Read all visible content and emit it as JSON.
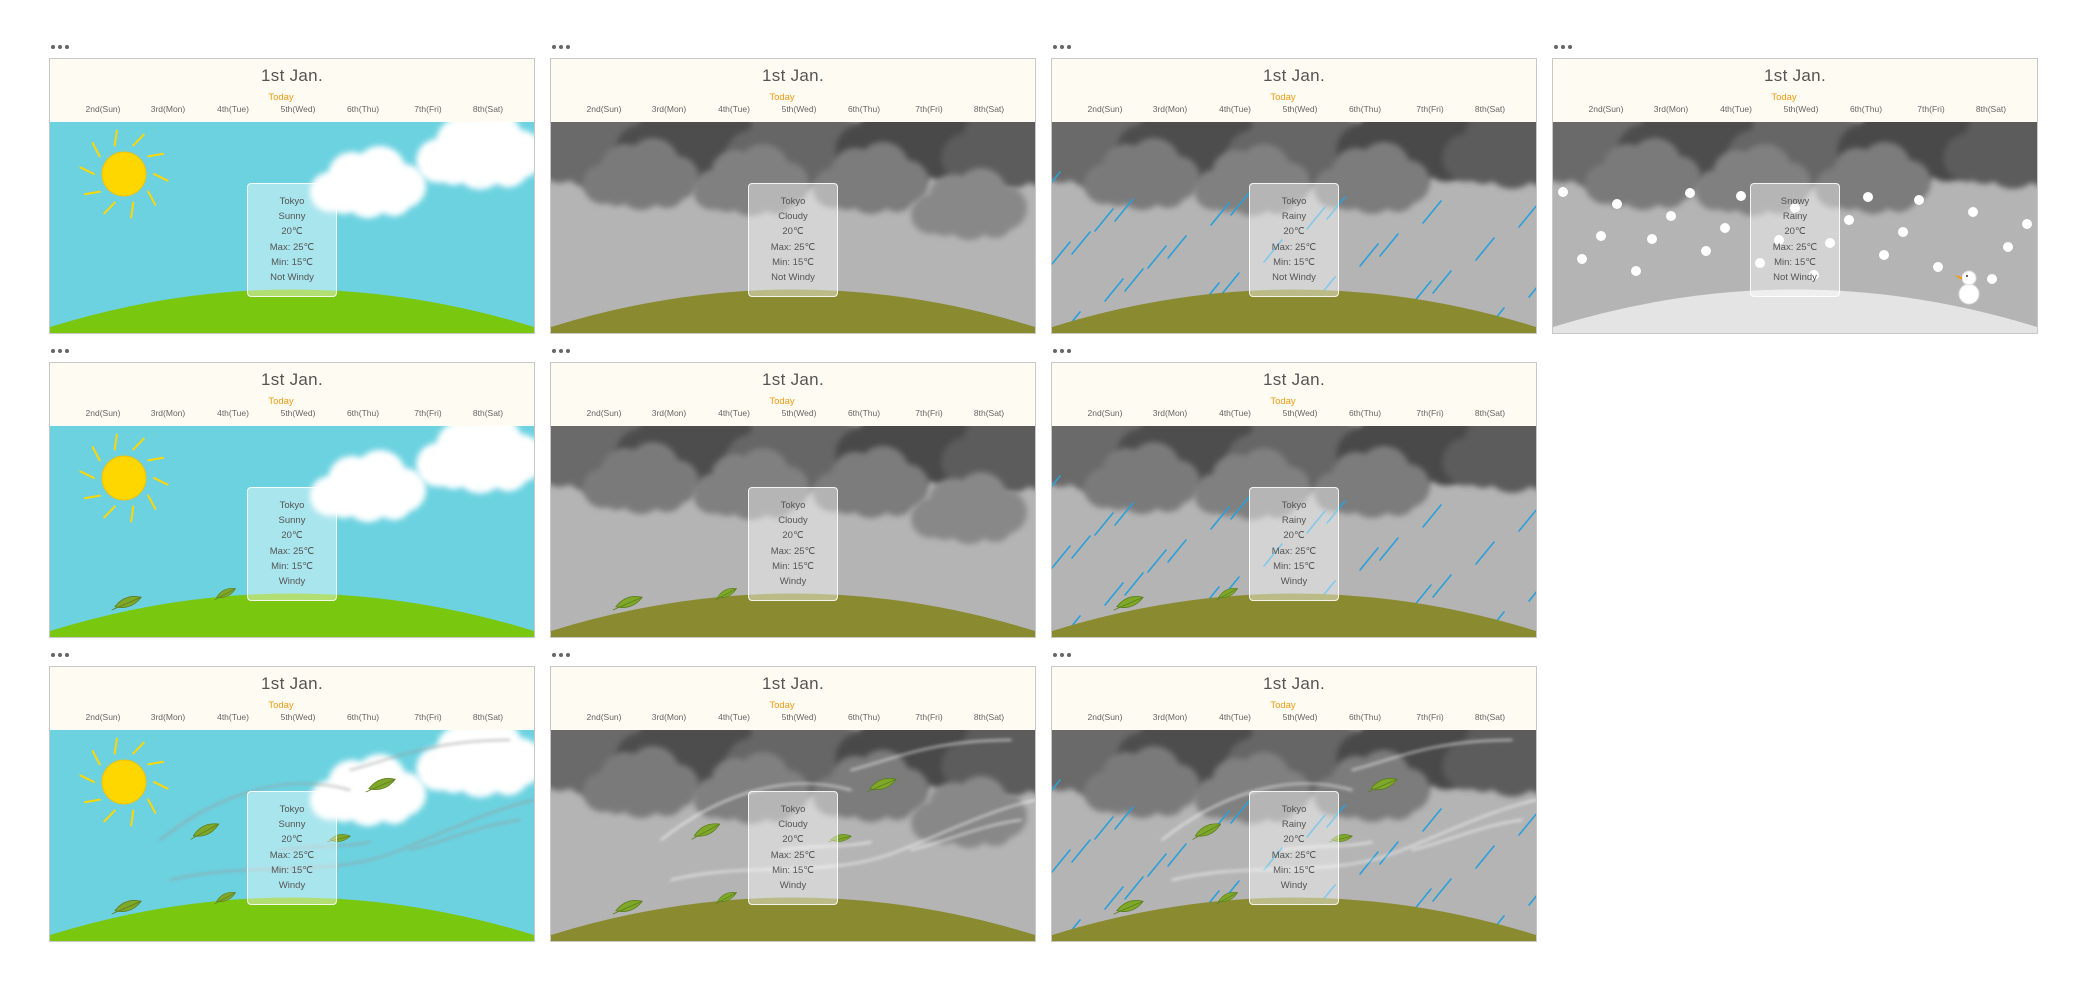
{
  "colors": {
    "today_accent": "#f39c12",
    "sky_clear": "#6cd2e0",
    "sky_overcast": "#b4b4b4",
    "grass_green": "#7ac70f",
    "grass_olive": "#8a8a31",
    "snow_ground": "#e4e4e4",
    "rain_streak": "#2aa0d8",
    "sun": "#ffd700"
  },
  "widgets": [
    {
      "date": "1st Jan.",
      "today_label": "Today",
      "days": [
        "2nd(Sun)",
        "3rd(Mon)",
        "4th(Tue)",
        "5th(Wed)",
        "6th(Thu)",
        "7th(Fri)",
        "8th(Sat)"
      ],
      "city": "Tokyo",
      "condition": "Sunny",
      "temp": "20℃",
      "max": "Max: 25℃",
      "min": "Min: 15℃",
      "wind": "Not Windy",
      "scene": "sunny",
      "windy": false,
      "gusts": false
    },
    {
      "date": "1st Jan.",
      "today_label": "Today",
      "days": [
        "2nd(Sun)",
        "3rd(Mon)",
        "4th(Tue)",
        "5th(Wed)",
        "6th(Thu)",
        "7th(Fri)",
        "8th(Sat)"
      ],
      "city": "Tokyo",
      "condition": "Cloudy",
      "temp": "20℃",
      "max": "Max: 25℃",
      "min": "Min: 15℃",
      "wind": "Not Windy",
      "scene": "cloudy",
      "windy": false,
      "gusts": false
    },
    {
      "date": "1st Jan.",
      "today_label": "Today",
      "days": [
        "2nd(Sun)",
        "3rd(Mon)",
        "4th(Tue)",
        "5th(Wed)",
        "6th(Thu)",
        "7th(Fri)",
        "8th(Sat)"
      ],
      "city": "Tokyo",
      "condition": "Rainy",
      "temp": "20℃",
      "max": "Max: 25℃",
      "min": "Min: 15℃",
      "wind": "Not Windy",
      "scene": "rainy",
      "windy": false,
      "gusts": false
    },
    {
      "date": "1st Jan.",
      "today_label": "Today",
      "days": [
        "2nd(Sun)",
        "3rd(Mon)",
        "4th(Tue)",
        "5th(Wed)",
        "6th(Thu)",
        "7th(Fri)",
        "8th(Sat)"
      ],
      "city": "Snowy",
      "condition": "Rainy",
      "temp": "20℃",
      "max": "Max: 25℃",
      "min": "Min: 15℃",
      "wind": "Not Windy",
      "scene": "snowy",
      "windy": false,
      "gusts": false
    },
    {
      "date": "1st Jan.",
      "today_label": "Today",
      "days": [
        "2nd(Sun)",
        "3rd(Mon)",
        "4th(Tue)",
        "5th(Wed)",
        "6th(Thu)",
        "7th(Fri)",
        "8th(Sat)"
      ],
      "city": "Tokyo",
      "condition": "Sunny",
      "temp": "20℃",
      "max": "Max: 25℃",
      "min": "Min: 15℃",
      "wind": "Windy",
      "scene": "sunny",
      "windy": true,
      "gusts": false
    },
    {
      "date": "1st Jan.",
      "today_label": "Today",
      "days": [
        "2nd(Sun)",
        "3rd(Mon)",
        "4th(Tue)",
        "5th(Wed)",
        "6th(Thu)",
        "7th(Fri)",
        "8th(Sat)"
      ],
      "city": "Tokyo",
      "condition": "Cloudy",
      "temp": "20℃",
      "max": "Max: 25℃",
      "min": "Min: 15℃",
      "wind": "Windy",
      "scene": "cloudy",
      "windy": true,
      "gusts": false
    },
    {
      "date": "1st Jan.",
      "today_label": "Today",
      "days": [
        "2nd(Sun)",
        "3rd(Mon)",
        "4th(Tue)",
        "5th(Wed)",
        "6th(Thu)",
        "7th(Fri)",
        "8th(Sat)"
      ],
      "city": "Tokyo",
      "condition": "Rainy",
      "temp": "20℃",
      "max": "Max: 25℃",
      "min": "Min: 15℃",
      "wind": "Windy",
      "scene": "rainy",
      "windy": true,
      "gusts": false
    },
    {
      "date": "1st Jan.",
      "today_label": "Today",
      "days": [
        "2nd(Sun)",
        "3rd(Mon)",
        "4th(Tue)",
        "5th(Wed)",
        "6th(Thu)",
        "7th(Fri)",
        "8th(Sat)"
      ],
      "city": "Tokyo",
      "condition": "Sunny",
      "temp": "20℃",
      "max": "Max: 25℃",
      "min": "Min: 15℃",
      "wind": "Windy",
      "scene": "sunny",
      "windy": true,
      "gusts": true
    },
    {
      "date": "1st Jan.",
      "today_label": "Today",
      "days": [
        "2nd(Sun)",
        "3rd(Mon)",
        "4th(Tue)",
        "5th(Wed)",
        "6th(Thu)",
        "7th(Fri)",
        "8th(Sat)"
      ],
      "city": "Tokyo",
      "condition": "Cloudy",
      "temp": "20℃",
      "max": "Max: 25℃",
      "min": "Min: 15℃",
      "wind": "Windy",
      "scene": "cloudy",
      "windy": true,
      "gusts": true
    },
    {
      "date": "1st Jan.",
      "today_label": "Today",
      "days": [
        "2nd(Sun)",
        "3rd(Mon)",
        "4th(Tue)",
        "5th(Wed)",
        "6th(Thu)",
        "7th(Fri)",
        "8th(Sat)"
      ],
      "city": "Tokyo",
      "condition": "Rainy",
      "temp": "20℃",
      "max": "Max: 25℃",
      "min": "Min: 15℃",
      "wind": "Windy",
      "scene": "rainy",
      "windy": true,
      "gusts": true
    }
  ]
}
